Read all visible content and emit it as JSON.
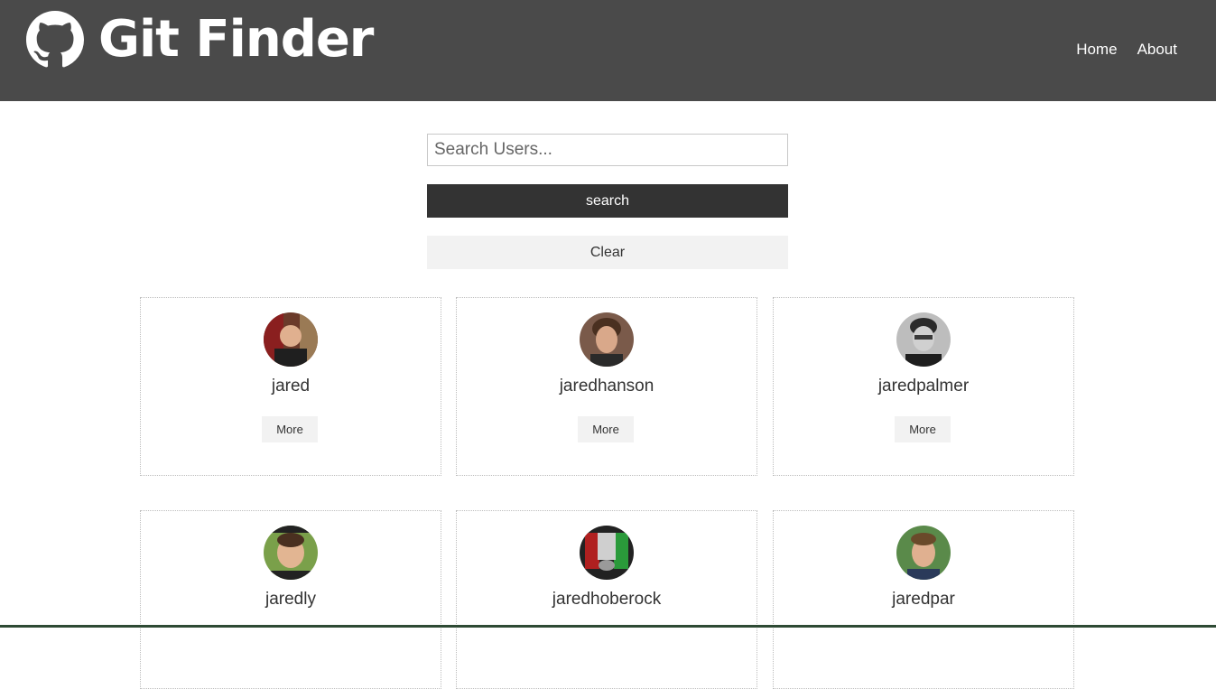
{
  "header": {
    "title": "Git Finder",
    "logo_icon": "github-octocat-icon",
    "nav": [
      {
        "label": "Home"
      },
      {
        "label": "About"
      }
    ]
  },
  "search": {
    "placeholder": "Search Users...",
    "value": "",
    "search_label": "search",
    "clear_label": "Clear"
  },
  "users": [
    {
      "login": "jared",
      "more_label": "More"
    },
    {
      "login": "jaredhanson",
      "more_label": "More"
    },
    {
      "login": "jaredpalmer",
      "more_label": "More"
    },
    {
      "login": "jaredly"
    },
    {
      "login": "jaredhoberock"
    },
    {
      "login": "jaredpar"
    }
  ],
  "colors": {
    "navbar_bg": "#4a4a4a",
    "primary_button": "#333333",
    "light_button": "#f2f2f2"
  }
}
